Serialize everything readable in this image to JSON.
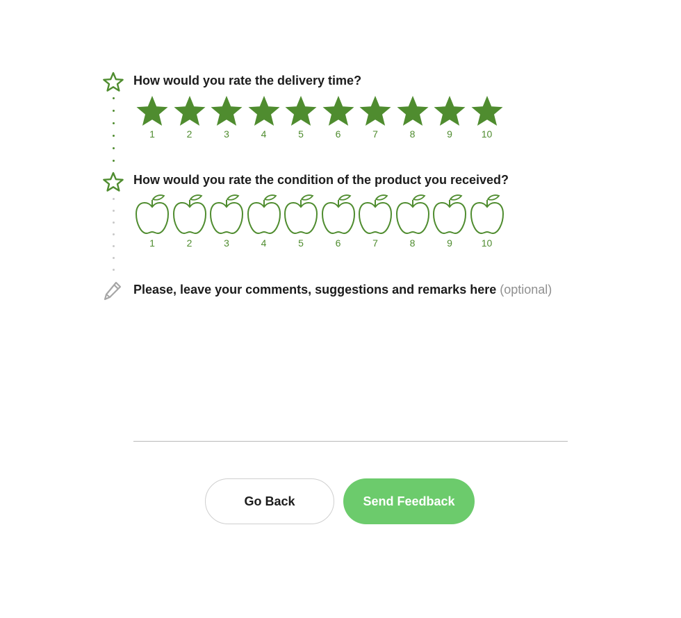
{
  "colors": {
    "accent": "#4f8c2f",
    "button_primary": "#6ccb6c",
    "dot_active": "#4f8c2f",
    "dot_inactive": "#c8c8c8",
    "muted": "#8f8f8f"
  },
  "questions": [
    {
      "icon": "star-outline-icon",
      "title": "How would you rate the delivery time?",
      "rating_icon": "filled-star-icon",
      "scale": [
        "1",
        "2",
        "3",
        "4",
        "5",
        "6",
        "7",
        "8",
        "9",
        "10"
      ],
      "selected": 10
    },
    {
      "icon": "star-outline-icon",
      "title": "How would you rate the condition of the product you received?",
      "rating_icon": "apple-outline-icon",
      "scale": [
        "1",
        "2",
        "3",
        "4",
        "5",
        "6",
        "7",
        "8",
        "9",
        "10"
      ],
      "selected": 0
    }
  ],
  "comments": {
    "icon": "pencil-icon",
    "title": "Please, leave your comments, suggestions and remarks here",
    "optional_label": "(optional)",
    "value": "",
    "placeholder": ""
  },
  "buttons": {
    "back_label": "Go Back",
    "send_label": "Send Feedback"
  }
}
